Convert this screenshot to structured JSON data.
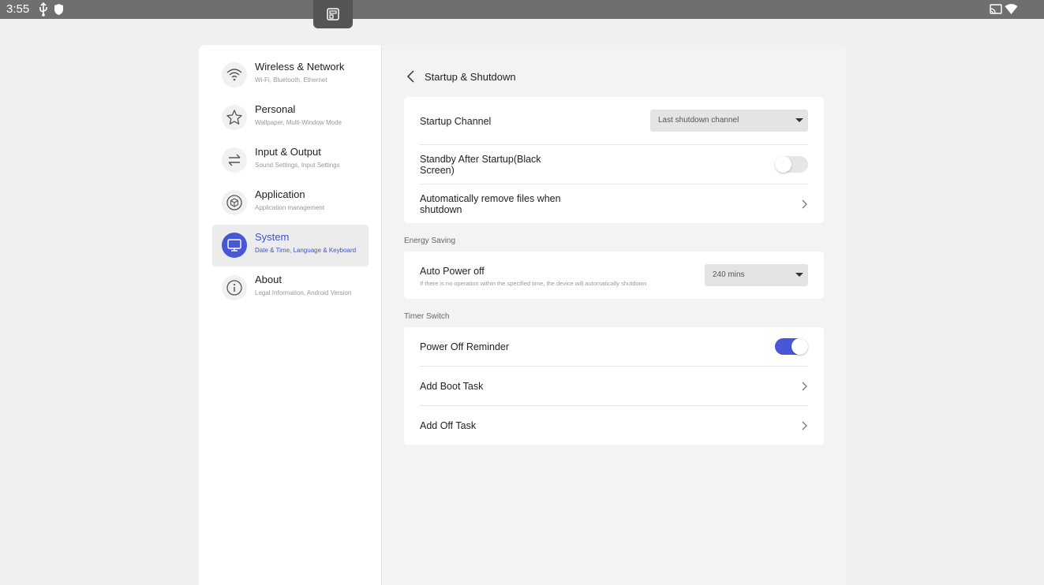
{
  "status_bar": {
    "time": "3:55",
    "icons": [
      "usb-icon",
      "shield-icon",
      "screenshot-icon",
      "cast-icon",
      "wifi-icon"
    ]
  },
  "sidebar": {
    "items": [
      {
        "title": "Wireless & Network",
        "subtitle": "Wi-Fi, Bluetooth, Ethernet",
        "icon": "wifi-icon",
        "active": false
      },
      {
        "title": "Personal",
        "subtitle": "Wallpaper, Multi-Window Mode",
        "icon": "star-icon",
        "active": false
      },
      {
        "title": "Input & Output",
        "subtitle": "Sound Settings, Input Settings",
        "icon": "swap-arrows-icon",
        "active": false
      },
      {
        "title": "Application",
        "subtitle": "Application management",
        "icon": "cube-icon",
        "active": false
      },
      {
        "title": "System",
        "subtitle": "Date & Time, Language & Keyboard",
        "icon": "monitor-icon",
        "active": true
      },
      {
        "title": "About",
        "subtitle": "Legal Information, Android Version",
        "icon": "info-icon",
        "active": false
      }
    ]
  },
  "content": {
    "title": "Startup & Shutdown",
    "startup": {
      "channel_label": "Startup Channel",
      "channel_value": "Last shutdown channel",
      "standby_label": "Standby After Startup(Black Screen)",
      "standby_on": false,
      "remove_files_label": "Automatically remove files when shutdown"
    },
    "energy": {
      "section_label": "Energy Saving",
      "auto_power_label": "Auto Power off",
      "auto_power_desc": "If there is no operation within the specified time, the device will automatically shutdown",
      "auto_power_value": "240 mins"
    },
    "timer": {
      "section_label": "Timer Switch",
      "reminder_label": "Power Off Reminder",
      "reminder_on": true,
      "boot_task_label": "Add Boot Task",
      "off_task_label": "Add Off Task"
    }
  },
  "colors": {
    "accent": "#4857d6",
    "status_bar": "#6f6f6f",
    "background": "#f0f0f0"
  }
}
